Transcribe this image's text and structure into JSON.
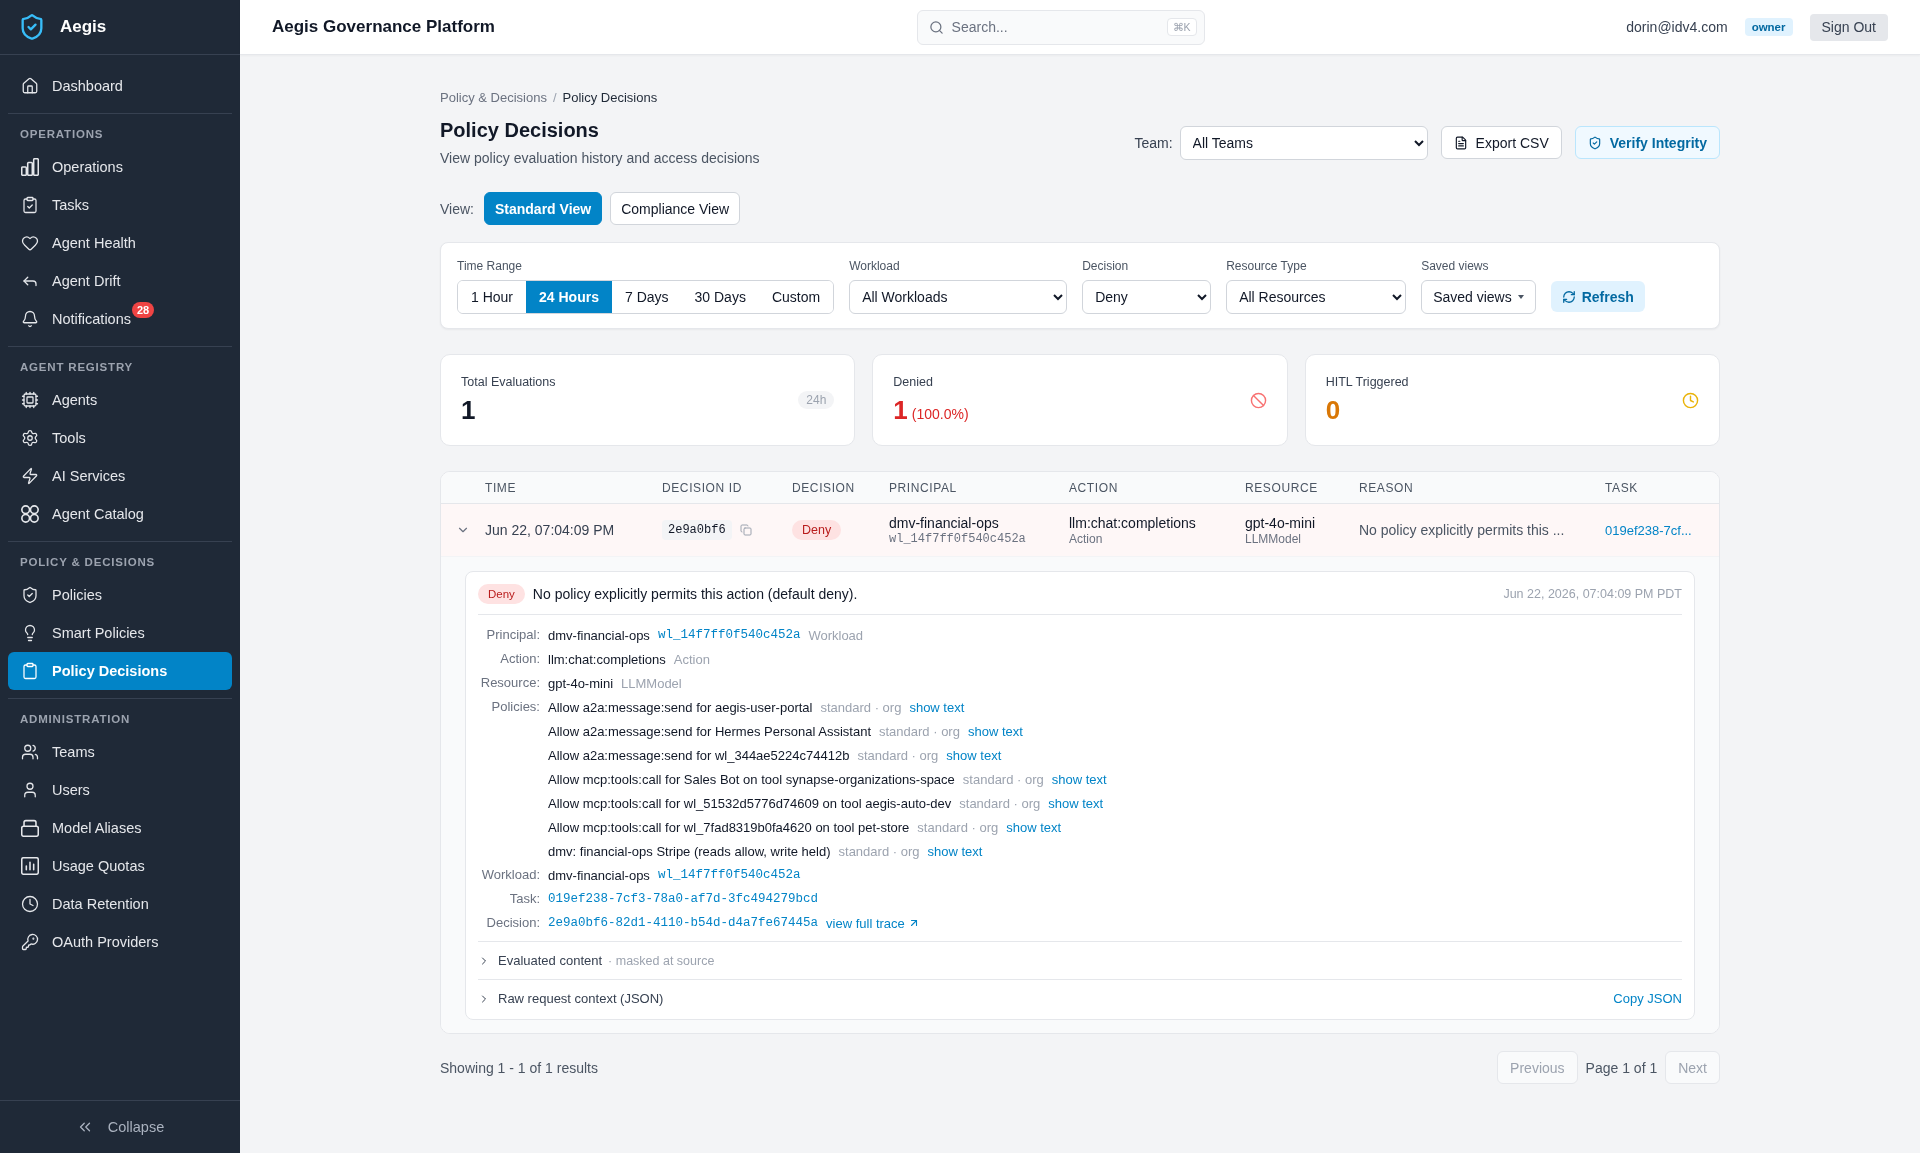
{
  "sidebar": {
    "brand": "Aegis",
    "sections": [
      {
        "items": [
          {
            "label": "Dashboard",
            "selected": false
          }
        ]
      },
      {
        "title": "OPERATIONS",
        "items": [
          {
            "label": "Operations",
            "selected": false
          },
          {
            "label": "Tasks",
            "selected": false
          },
          {
            "label": "Agent Health",
            "selected": false
          },
          {
            "label": "Agent Drift",
            "selected": false
          },
          {
            "label": "Notifications",
            "badge": "28",
            "selected": false
          }
        ]
      },
      {
        "title": "AGENT REGISTRY",
        "items": [
          {
            "label": "Agents",
            "selected": false
          },
          {
            "label": "Tools",
            "selected": false
          },
          {
            "label": "AI Services",
            "selected": false
          },
          {
            "label": "Agent Catalog",
            "selected": false
          }
        ]
      },
      {
        "title": "POLICY & DECISIONS",
        "items": [
          {
            "label": "Policies",
            "selected": false
          },
          {
            "label": "Smart Policies",
            "selected": false
          },
          {
            "label": "Policy Decisions",
            "selected": true
          }
        ]
      },
      {
        "title": "ADMINISTRATION",
        "items": [
          {
            "label": "Teams",
            "selected": false
          },
          {
            "label": "Users",
            "selected": false
          },
          {
            "label": "Model Aliases",
            "selected": false
          },
          {
            "label": "Usage Quotas",
            "selected": false
          },
          {
            "label": "Data Retention",
            "selected": false
          },
          {
            "label": "OAuth Providers",
            "selected": false
          }
        ]
      }
    ],
    "collapse": "Collapse"
  },
  "header": {
    "title": "Aegis Governance Platform",
    "search": {
      "placeholder": "Search...",
      "shortcut": "⌘K"
    },
    "user": "dorin@idv4.com",
    "role": "owner",
    "sign_out": "Sign Out"
  },
  "page": {
    "breadcrumb": {
      "items": [
        "Policy & Decisions",
        "Policy Decisions"
      ],
      "separator": "/"
    },
    "title": "Policy Decisions",
    "subtitle": "View policy evaluation history and access decisions",
    "team": {
      "label": "Team:",
      "value": "All Teams"
    },
    "actions": [
      {
        "label": "Export CSV",
        "kind": "export"
      },
      {
        "label": "Verify Integrity",
        "kind": "verify"
      }
    ],
    "view": {
      "label": "View:",
      "options": [
        {
          "label": "Standard View",
          "selected": true
        },
        {
          "label": "Compliance View",
          "selected": false
        }
      ]
    },
    "filters": {
      "time_range": {
        "label": "Time Range",
        "options": [
          {
            "label": "1 Hour",
            "selected": false
          },
          {
            "label": "24 Hours",
            "selected": true
          },
          {
            "label": "7 Days",
            "selected": false
          },
          {
            "label": "30 Days",
            "selected": false
          },
          {
            "label": "Custom",
            "selected": false
          }
        ]
      },
      "selects": [
        {
          "label": "Workload",
          "value": "All Workloads"
        },
        {
          "label": "Decision",
          "value": "Deny"
        },
        {
          "label": "Resource Type",
          "value": "All Resources"
        }
      ],
      "saved_views": {
        "label": "Saved views",
        "button": "Saved views"
      },
      "refresh": "Refresh"
    },
    "stats": [
      {
        "kind": "total",
        "label": "Total Evaluations",
        "value": "1",
        "badge": "24h"
      },
      {
        "kind": "denied",
        "label": "Denied",
        "value": "1",
        "detail": "(100.0%)"
      },
      {
        "kind": "hitl",
        "label": "HITL Triggered",
        "value": "0"
      }
    ],
    "table": {
      "columns": [
        "TIME",
        "DECISION ID",
        "DECISION",
        "PRINCIPAL",
        "ACTION",
        "RESOURCE",
        "REASON",
        "TASK"
      ],
      "rows": [
        {
          "expanded": true,
          "time": "Jun 22, 07:04:09 PM",
          "decision_id": "2e9a0bf6",
          "decision": {
            "label": "Deny",
            "kind": "deny"
          },
          "principal": {
            "name": "dmv-financial-ops",
            "id": "wl_14f7ff0f540c452a"
          },
          "action": {
            "name": "llm:chat:completions",
            "type": "Action"
          },
          "resource": {
            "name": "gpt-4o-mini",
            "type": "LLMModel"
          },
          "reason": "No policy explicitly permits this ...",
          "task": "019ef238-7cf...",
          "detail": {
            "decision": {
              "label": "Deny",
              "kind": "deny"
            },
            "summary": "No policy explicitly permits this action (default deny).",
            "timestamp": "Jun 22, 2026, 07:04:09 PM PDT",
            "fields": [
              {
                "label": "Principal:",
                "value": "dmv-financial-ops",
                "id": "wl_14f7ff0f540c452a",
                "type": "Workload"
              },
              {
                "label": "Action:",
                "value": "llm:chat:completions",
                "type": "Action"
              },
              {
                "label": "Resource:",
                "value": "gpt-4o-mini",
                "type": "LLMModel"
              },
              {
                "label": "Policies:",
                "policies": [
                  {
                    "name": "Allow a2a:message:send for aegis-user-portal",
                    "meta": "standard · org",
                    "link": "show text"
                  },
                  {
                    "name": "Allow a2a:message:send for Hermes Personal Assistant",
                    "meta": "standard · org",
                    "link": "show text"
                  },
                  {
                    "name": "Allow a2a:message:send for wl_344ae5224c74412b",
                    "meta": "standard · org",
                    "link": "show text"
                  },
                  {
                    "name": "Allow mcp:tools:call for Sales Bot on tool synapse-organizations-space",
                    "meta": "standard · org",
                    "link": "show text"
                  },
                  {
                    "name": "Allow mcp:tools:call for wl_51532d5776d74609 on tool aegis-auto-dev",
                    "meta": "standard · org",
                    "link": "show text"
                  },
                  {
                    "name": "Allow mcp:tools:call for wl_7fad8319b0fa4620 on tool pet-store",
                    "meta": "standard · org",
                    "link": "show text"
                  },
                  {
                    "name": "dmv: financial-ops Stripe (reads allow, write held)",
                    "meta": "standard · org",
                    "link": "show text"
                  }
                ]
              },
              {
                "label": "Workload:",
                "value": "dmv-financial-ops",
                "id": "wl_14f7ff0f540c452a"
              },
              {
                "label": "Task:",
                "id": "019ef238-7cf3-78a0-af7d-3fc494279bcd"
              },
              {
                "label": "Decision:",
                "id": "2e9a0bf6-82d1-4110-b54d-d4a7fe67445a",
                "link": "view full trace"
              }
            ],
            "sections": [
              {
                "title": "Evaluated content",
                "note": "· masked at source",
                "expanded": false
              },
              {
                "title": "Raw request context (JSON)",
                "action": "Copy JSON",
                "expanded": false
              }
            ]
          }
        }
      ]
    },
    "pagination": {
      "summary": "Showing 1 - 1 of 1 results",
      "previous": {
        "label": "Previous",
        "disabled": true
      },
      "page": "Page 1 of 1",
      "next": {
        "label": "Next",
        "disabled": true
      }
    }
  }
}
